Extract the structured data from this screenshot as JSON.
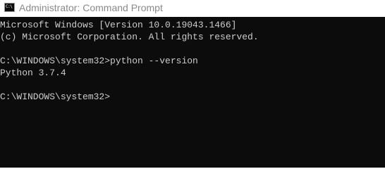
{
  "window": {
    "title": "Administrator: Command Prompt",
    "icon_glyph": "C:\\",
    "icon_name": "command-prompt-icon"
  },
  "console": {
    "lines": [
      "Microsoft Windows [Version 10.0.19043.1466]",
      "(c) Microsoft Corporation. All rights reserved.",
      "",
      "C:\\WINDOWS\\system32>python --version",
      "Python 3.7.4",
      "",
      "C:\\WINDOWS\\system32>"
    ],
    "colors": {
      "background": "#0c0c0c",
      "text": "#cccccc"
    }
  }
}
